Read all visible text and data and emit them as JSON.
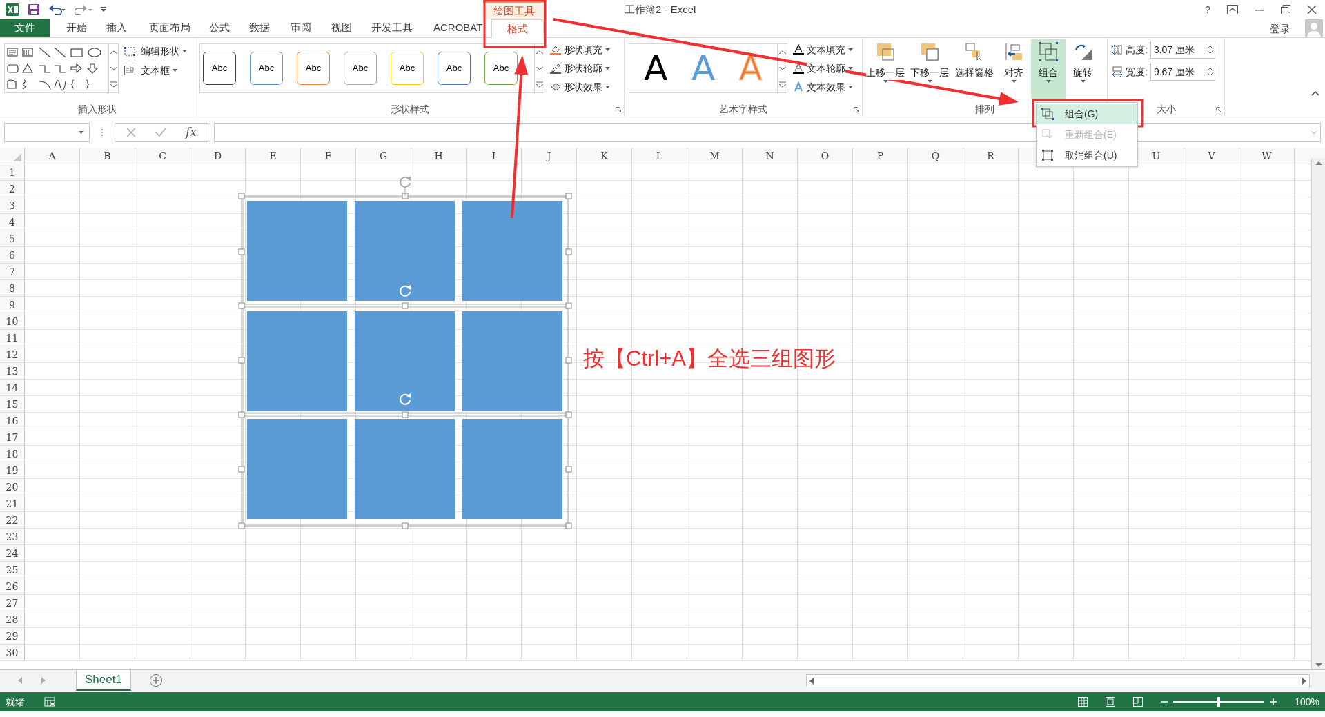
{
  "window": {
    "title": "工作簿2 - Excel",
    "help": "?"
  },
  "contextual_group": "绘图工具",
  "tabs": [
    {
      "label": "文件",
      "kind": "file",
      "selected": false
    },
    {
      "label": "开始",
      "kind": "tab",
      "selected": false
    },
    {
      "label": "插入",
      "kind": "tab",
      "selected": false
    },
    {
      "label": "页面布局",
      "kind": "tab",
      "selected": false
    },
    {
      "label": "公式",
      "kind": "tab",
      "selected": false
    },
    {
      "label": "数据",
      "kind": "tab",
      "selected": false
    },
    {
      "label": "审阅",
      "kind": "tab",
      "selected": false
    },
    {
      "label": "视图",
      "kind": "tab",
      "selected": false
    },
    {
      "label": "开发工具",
      "kind": "tab",
      "selected": false
    },
    {
      "label": "ACROBAT",
      "kind": "tab",
      "selected": false
    },
    {
      "label": "格式",
      "kind": "contextual",
      "selected": true
    }
  ],
  "sign_in": "登录",
  "insert_shapes": {
    "label": "插入形状",
    "buttons": [
      "编辑形状",
      "文本框"
    ]
  },
  "shape_styles": {
    "label": "形状样式",
    "presets": [
      {
        "text": "Abc",
        "color": "#404040"
      },
      {
        "text": "Abc",
        "color": "#5b9bd5"
      },
      {
        "text": "Abc",
        "color": "#ed7d31"
      },
      {
        "text": "Abc",
        "color": "#a5a5a5"
      },
      {
        "text": "Abc",
        "color": "#ffc000"
      },
      {
        "text": "Abc",
        "color": "#4472c4"
      },
      {
        "text": "Abc",
        "color": "#70ad47"
      }
    ],
    "commands": [
      "形状填充",
      "形状轮廓",
      "形状效果"
    ]
  },
  "wordart_styles": {
    "label": "艺术字样式",
    "presets": [
      {
        "text": "A",
        "color": "#000000",
        "kind": "solid"
      },
      {
        "text": "A",
        "color": "#5b9bd5",
        "kind": "solid"
      },
      {
        "text": "A",
        "color": "#ed7d31",
        "kind": "outline"
      }
    ],
    "commands": [
      "文本填充",
      "文本轮廓",
      "文本效果"
    ]
  },
  "arrange": {
    "label": "排列",
    "buttons": [
      {
        "label": "上移一层",
        "selected": false
      },
      {
        "label": "下移一层",
        "selected": false
      },
      {
        "label": "选择窗格",
        "selected": false
      },
      {
        "label": "对齐",
        "selected": false
      },
      {
        "label": "组合",
        "selected": true
      },
      {
        "label": "旋转",
        "selected": false
      }
    ]
  },
  "size": {
    "label": "大小",
    "height_label": "高度:",
    "height": "3.07 厘米",
    "width_label": "宽度:",
    "width": "9.67 厘米"
  },
  "formula_bar": {
    "fx": "fx"
  },
  "grid": {
    "columns": [
      "A",
      "B",
      "C",
      "D",
      "E",
      "F",
      "G",
      "H",
      "I",
      "J",
      "K",
      "L",
      "M",
      "N",
      "O",
      "P",
      "Q",
      "R"
    ],
    "columns_after_menu": [
      "U",
      "V",
      "W"
    ],
    "rows": [
      "1",
      "2",
      "3",
      "4",
      "5",
      "6",
      "7",
      "8",
      "9",
      "10",
      "11",
      "12",
      "13",
      "14",
      "15",
      "16",
      "17",
      "18",
      "19",
      "20",
      "21",
      "22",
      "23",
      "24",
      "25",
      "26",
      "27",
      "28",
      "29",
      "30"
    ]
  },
  "group_menu": [
    {
      "label": "组合(G)",
      "selected": true,
      "disabled": false
    },
    {
      "label": "重新组合(E)",
      "selected": false,
      "disabled": true
    },
    {
      "label": "取消组合(U)",
      "selected": false,
      "disabled": false
    }
  ],
  "annotation": "按【Ctrl+A】全选三组图形",
  "sheet_tabs": [
    {
      "label": "Sheet1",
      "selected": true
    }
  ],
  "status_bar": {
    "status": "就绪",
    "zoom_slider": {
      "level": 0.5
    },
    "zoom": "100%"
  }
}
